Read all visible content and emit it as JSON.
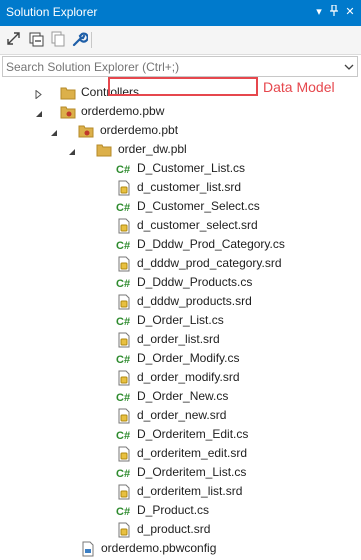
{
  "window": {
    "title": "Solution Explorer"
  },
  "search": {
    "placeholder": "Search Solution Explorer (Ctrl+;)"
  },
  "toolbar": {
    "icons": [
      "sync-icon",
      "collapse-all-icon",
      "show-all-files-icon",
      "properties-wrench-icon"
    ]
  },
  "colors": {
    "title_bar": "#007acc",
    "annotation": "#e6474d",
    "cs_icon": "#2e8b2e",
    "folder": "#dcb04a"
  },
  "annotation": "Data Model",
  "tree": {
    "controllers": "Controllers",
    "pbw": "orderdemo.pbw",
    "pbt": "orderdemo.pbt",
    "pbl": "order_dw.pbl",
    "files": [
      "D_Customer_List.cs",
      "d_customer_list.srd",
      "D_Customer_Select.cs",
      "d_customer_select.srd",
      "D_Dddw_Prod_Category.cs",
      "d_dddw_prod_category.srd",
      "D_Dddw_Products.cs",
      "d_dddw_products.srd",
      "D_Order_List.cs",
      "d_order_list.srd",
      "D_Order_Modify.cs",
      "d_order_modify.srd",
      "D_Order_New.cs",
      "d_order_new.srd",
      "D_Orderitem_Edit.cs",
      "d_orderitem_edit.srd",
      "D_Orderitem_List.cs",
      "d_orderitem_list.srd",
      "D_Product.cs",
      "d_product.srd"
    ],
    "config": "orderdemo.pbwconfig"
  }
}
